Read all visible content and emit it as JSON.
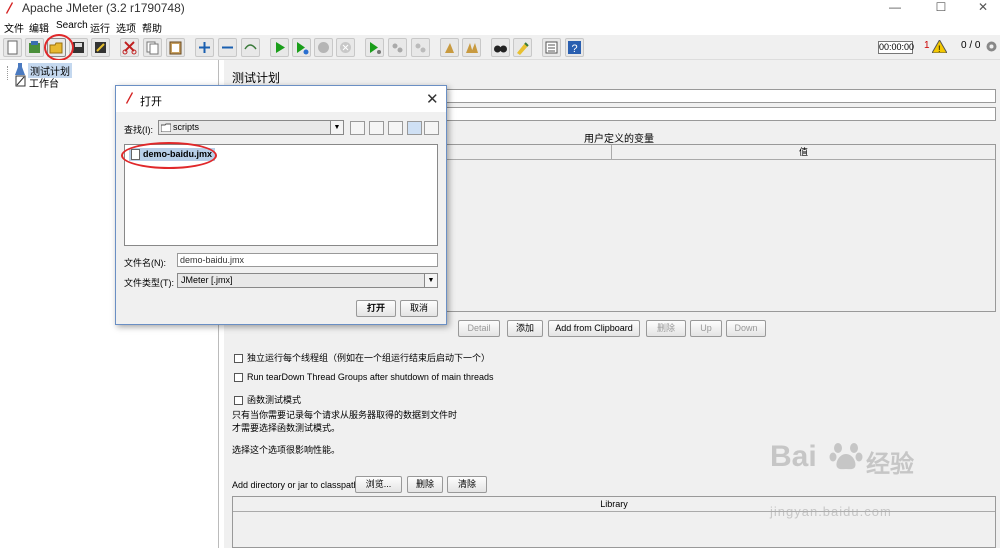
{
  "window": {
    "title": "Apache JMeter (3.2 r1790748)",
    "minimize": "—",
    "maximize": "☐",
    "close": "✕"
  },
  "menu": [
    "文件",
    "编辑",
    "Search",
    "运行",
    "选项",
    "帮助"
  ],
  "toolbar": {
    "timer": "00:00:00",
    "warnings": "1",
    "threads": "0 / 0"
  },
  "tree": {
    "items": [
      "测试计划",
      "工作台"
    ]
  },
  "panel": {
    "title": "测试计划",
    "user_vars_label": "用户定义的变量",
    "value_col": "值",
    "buttons": {
      "detail": "Detail",
      "add": "添加",
      "add_clipboard": "Add from Clipboard",
      "delete": "删除",
      "up": "Up",
      "down": "Down"
    },
    "options": [
      "独立运行每个线程组（例如在一个组运行结束后启动下一个）",
      "Run tearDown Thread Groups after shutdown of main threads",
      "函数测试模式"
    ],
    "note_lines": [
      "只有当你需要记录每个请求从服务器取得的数据到文件时",
      "才需要选择函数测试模式。"
    ],
    "perf_note": "选择这个选项很影响性能。",
    "classpath_label": "Add directory or jar to classpath",
    "classpath_buttons": {
      "browse": "浏览...",
      "delete": "删除",
      "clear": "清除"
    },
    "library_col": "Library"
  },
  "dialog": {
    "title": "打开",
    "look_in_label": "查找(I):",
    "look_in_value": "scripts",
    "files": [
      "demo-baidu.jmx"
    ],
    "filename_label": "文件名(N):",
    "filename_value": "demo-baidu.jmx",
    "filetype_label": "文件类型(T):",
    "filetype_value": "JMeter [.jmx]",
    "open_button": "打开",
    "cancel_button": "取消"
  },
  "watermark": {
    "brand": "Bai",
    "brand2": "经验",
    "url": "jingyan.baidu.com"
  },
  "colors": {
    "highlight_oval": "#e0282a",
    "selection": "#b8cfe8",
    "play": "#1a9e1a"
  }
}
